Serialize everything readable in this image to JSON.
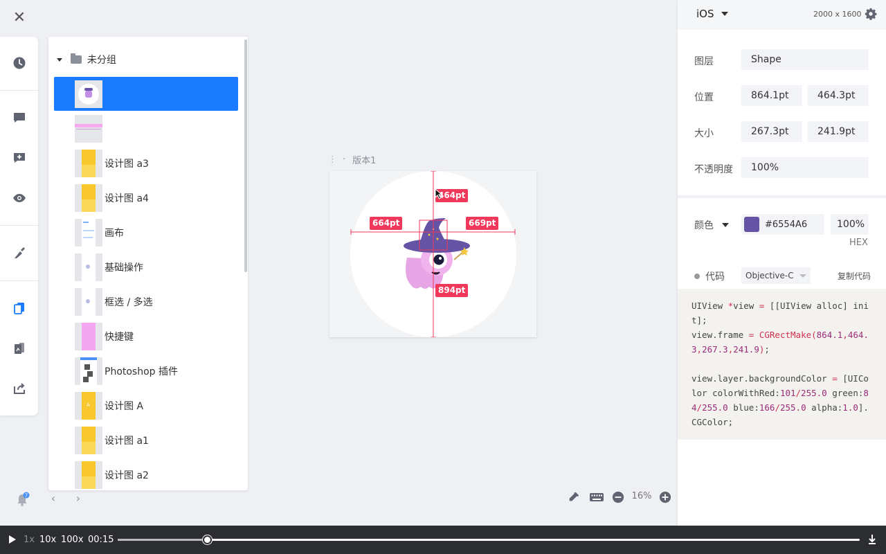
{
  "close_label": "✕",
  "layers": {
    "group_name": "未分组",
    "items": [
      {
        "label": "",
        "selected": true,
        "thumb": "wizard"
      },
      {
        "label": "",
        "selected": false,
        "thumb": "banner"
      },
      {
        "label": "设计图 a3",
        "selected": false,
        "thumb": "yellow"
      },
      {
        "label": "设计图 a4",
        "selected": false,
        "thumb": "yellow"
      },
      {
        "label": "画布",
        "selected": false,
        "thumb": "doc-blue"
      },
      {
        "label": "基础操作",
        "selected": false,
        "thumb": "doc"
      },
      {
        "label": "框选 / 多选",
        "selected": false,
        "thumb": "doc"
      },
      {
        "label": "快捷键",
        "selected": false,
        "thumb": "pink"
      },
      {
        "label": "Photoshop 插件",
        "selected": false,
        "thumb": "ps"
      },
      {
        "label": "设计图 A",
        "selected": false,
        "thumb": "yellow-a"
      },
      {
        "label": "设计图 a1",
        "selected": false,
        "thumb": "yellow"
      },
      {
        "label": "设计图 a2",
        "selected": false,
        "thumb": "yellow"
      }
    ]
  },
  "canvas": {
    "version_label": "版本1",
    "measurements": {
      "top": "464pt",
      "left": "664pt",
      "right": "669pt",
      "bottom": "894pt"
    },
    "zoom": "16%"
  },
  "inspector": {
    "platform": "iOS",
    "canvas_size": "2000 x 1600",
    "layer_label": "图层",
    "layer_value": "Shape",
    "position_label": "位置",
    "position_x": "864.1pt",
    "position_y": "464.3pt",
    "size_label": "大小",
    "size_w": "267.3pt",
    "size_h": "241.9pt",
    "opacity_label": "不透明度",
    "opacity_value": "100%",
    "color_label": "颜色",
    "color_hex": "#6554A6",
    "color_swatch": "#6554A6",
    "color_opacity": "100%",
    "color_format": "HEX",
    "code_label": "代码",
    "code_language": "Objective-C",
    "copy_code": "复制代码"
  },
  "timeline": {
    "speed_1x": "1x",
    "speed_10x": "10x",
    "speed_100x": "100x",
    "time": "00:15",
    "progress": 0.12
  },
  "notification_count": "7"
}
